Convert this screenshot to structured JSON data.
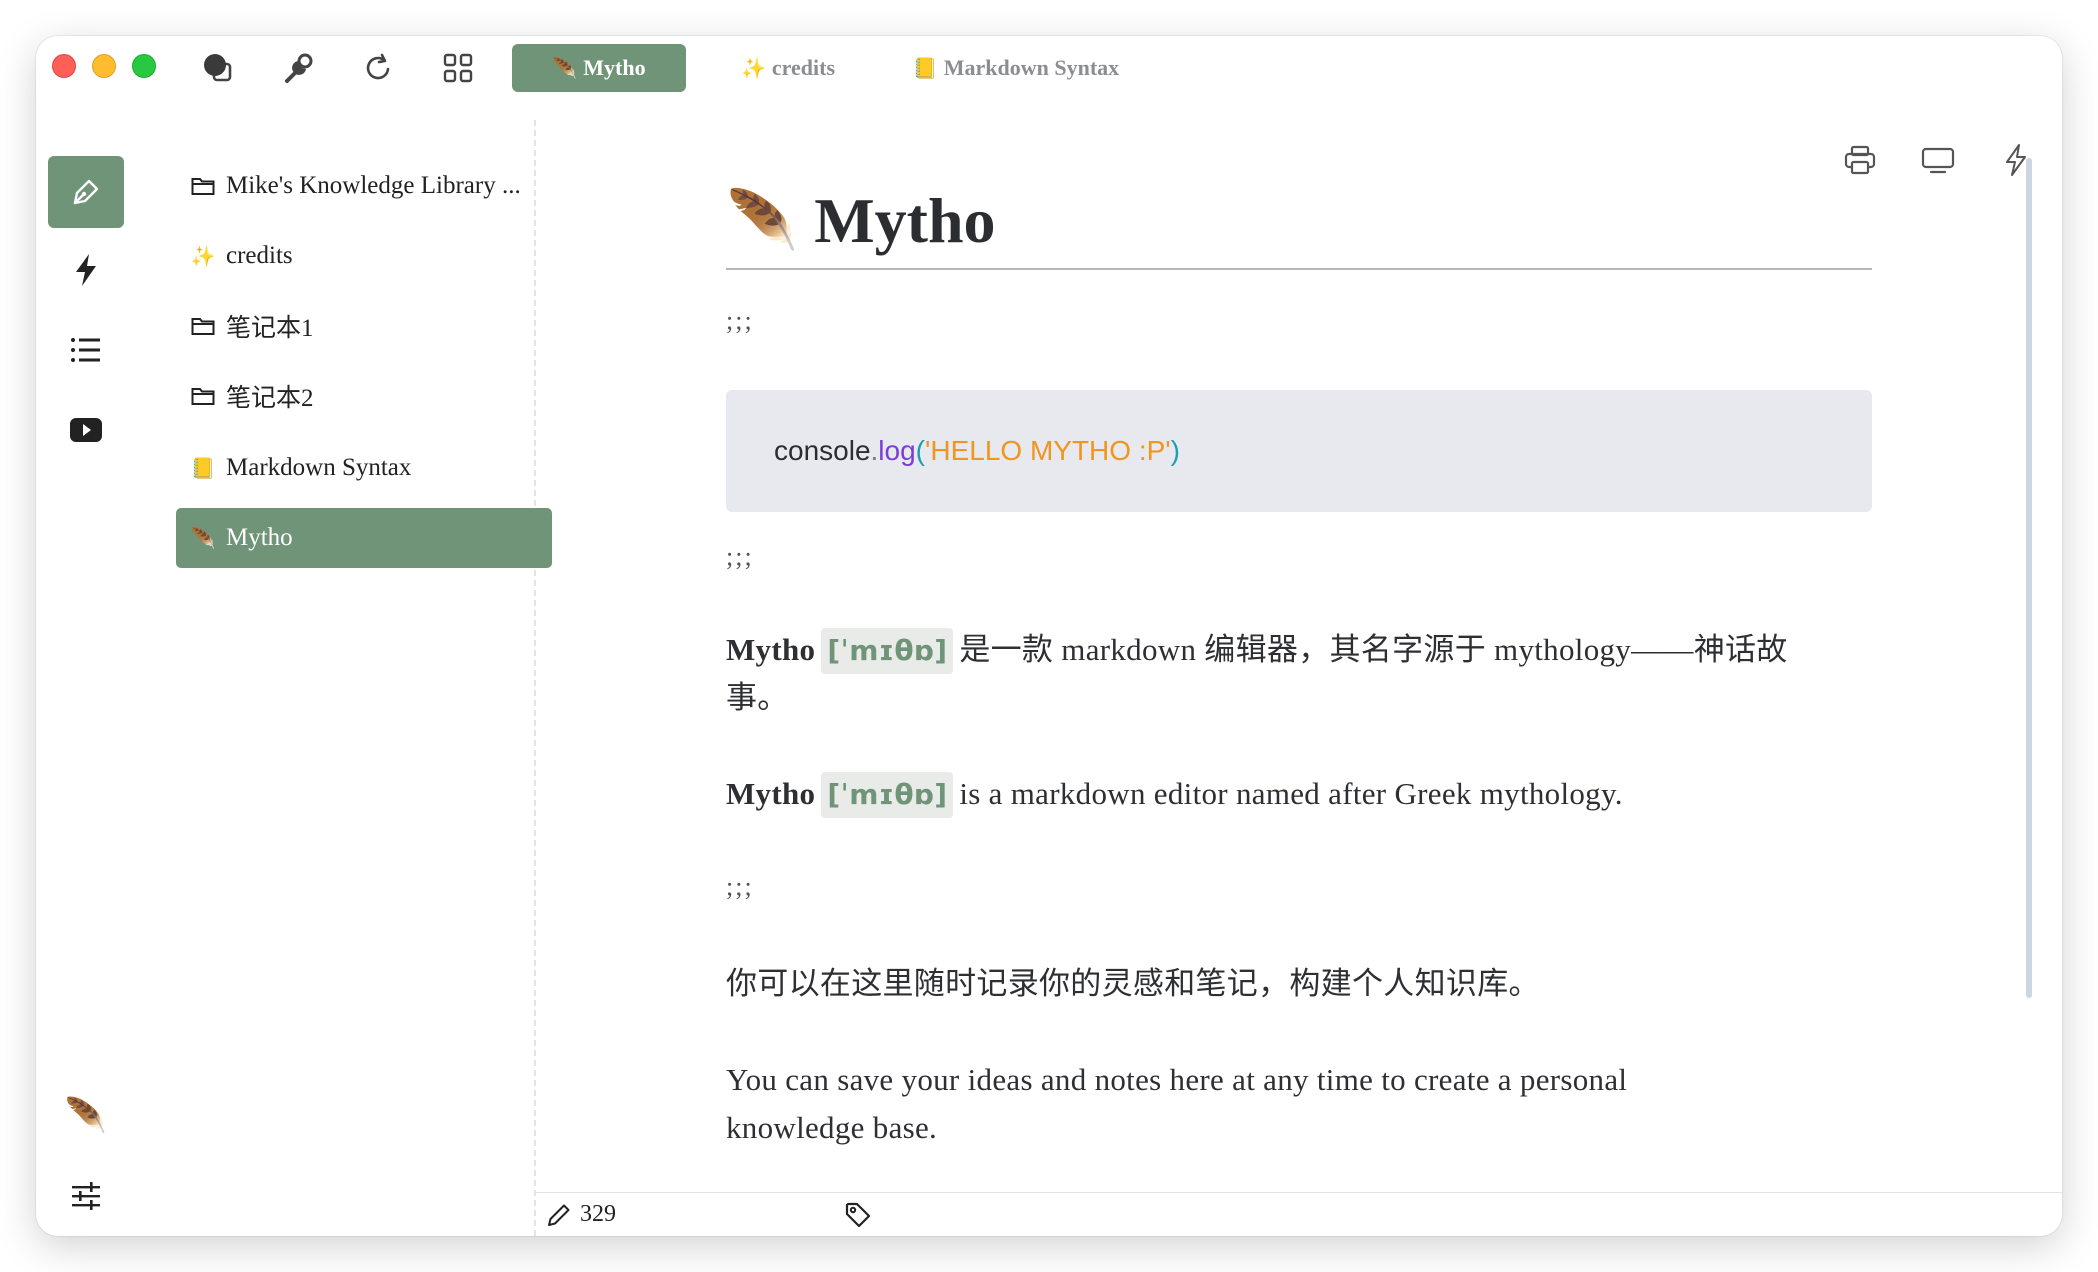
{
  "tabs": [
    {
      "icon": "🪶",
      "label": "Mytho",
      "active": true
    },
    {
      "icon": "✨",
      "label": "credits",
      "active": false
    },
    {
      "icon": "📒",
      "label": "Markdown Syntax",
      "active": false
    }
  ],
  "file_tree": [
    {
      "icon": "folder-icon",
      "label": "Mike's Knowledge Library ..."
    },
    {
      "icon": "sparkles-icon",
      "glyph": "✨",
      "label": "credits"
    },
    {
      "icon": "folder-icon",
      "label": "笔记本1"
    },
    {
      "icon": "folder-icon",
      "label": "笔记本2"
    },
    {
      "icon": "notebook-icon",
      "glyph": "📒",
      "label": "Markdown Syntax"
    },
    {
      "icon": "feather-icon",
      "glyph": "🪶",
      "label": "Mytho",
      "active": true
    }
  ],
  "document": {
    "title_glyph": "🪶",
    "title": "Mytho",
    "separator": ";;;",
    "code": {
      "object": "console",
      "dot": ".",
      "fn": "log",
      "open": "(",
      "string": "'HELLO MYTHO :P'",
      "close": ")"
    },
    "para_zh_1": {
      "name": "Mytho",
      "ipa": "[ˈmɪθɒ]",
      "text": "是一款 markdown 编辑器，其名字源于 mythology——神话故事。"
    },
    "para_en_1": {
      "name": "Mytho",
      "ipa": "[ˈmɪθɒ]",
      "text": "is a markdown editor named after Greek mythology."
    },
    "para_zh_2": "你可以在这里随时记录你的灵感和笔记，构建个人知识库。",
    "para_en_2": "You can save your ideas and notes here at any time to create a personal knowledge base."
  },
  "status": {
    "word_count": "329"
  },
  "colors": {
    "accent": "#6f9478",
    "code_bg": "#e7e9ee"
  }
}
